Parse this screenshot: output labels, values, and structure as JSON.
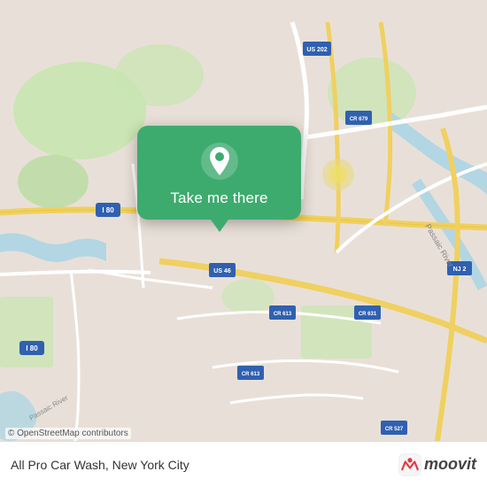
{
  "map": {
    "attribution": "© OpenStreetMap contributors",
    "location_label": "All Pro Car Wash, New York City"
  },
  "popup": {
    "button_label": "Take me there"
  },
  "logo": {
    "text": "moovit"
  },
  "colors": {
    "map_bg": "#e8e0d8",
    "green_card": "#3dab6e",
    "road_main": "#ffffff",
    "road_secondary": "#f5f0e8",
    "road_yellow": "#f0d060",
    "water": "#a8d4e6",
    "greenspace": "#c8e6b0"
  }
}
